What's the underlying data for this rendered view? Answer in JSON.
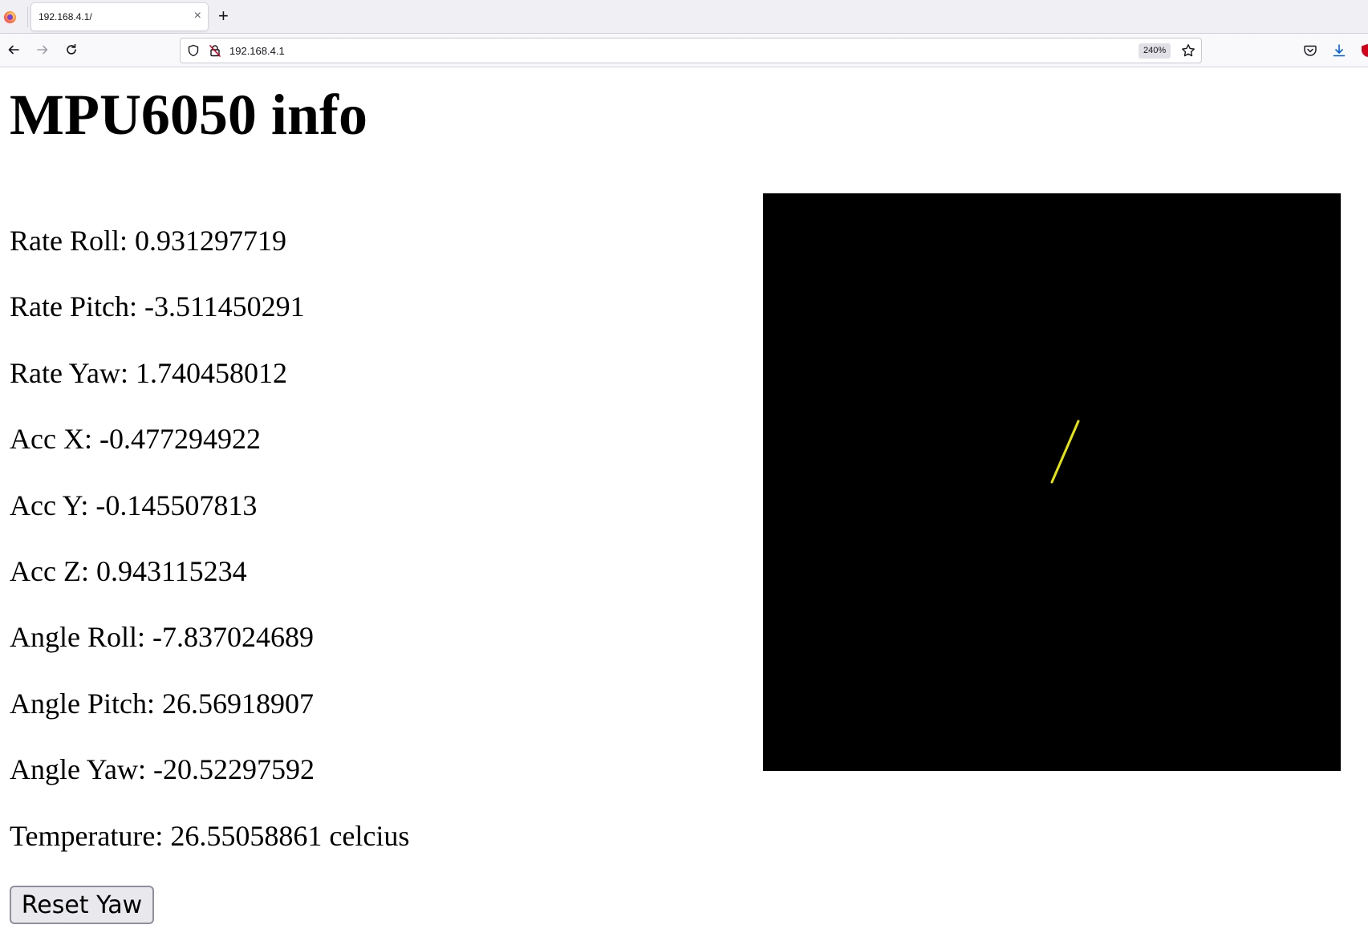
{
  "browser": {
    "tab_title": "192.168.4.1/",
    "url": "192.168.4.1",
    "zoom": "240%"
  },
  "page": {
    "title": "MPU6050 info",
    "readings": [
      {
        "label": "Rate Roll",
        "value": "0.931297719"
      },
      {
        "label": "Rate Pitch",
        "value": "-3.511450291"
      },
      {
        "label": "Rate Yaw",
        "value": "1.740458012"
      },
      {
        "label": "Acc X",
        "value": "-0.477294922"
      },
      {
        "label": "Acc Y",
        "value": "-0.145507813"
      },
      {
        "label": "Acc Z",
        "value": "0.943115234"
      },
      {
        "label": "Angle Roll",
        "value": "-7.837024689"
      },
      {
        "label": "Angle Pitch",
        "value": "26.56918907"
      },
      {
        "label": "Angle Yaw",
        "value": "-20.52297592"
      },
      {
        "label": "Temperature",
        "value": "26.55058861 celcius"
      }
    ],
    "reset_button": "Reset Yaw",
    "visualization": {
      "background": "#000000",
      "line_color": "#e6e600"
    }
  },
  "icons": {
    "browser_logo": "firefox-icon",
    "close": "close-icon",
    "new_tab": "plus-icon",
    "back": "back-arrow-icon",
    "forward": "forward-arrow-icon",
    "reload": "reload-icon",
    "shield": "shield-icon",
    "insecure": "insecure-lock-icon",
    "bookmark": "star-icon",
    "pocket": "pocket-icon",
    "downloads": "download-icon",
    "extension": "ublock-icon"
  }
}
